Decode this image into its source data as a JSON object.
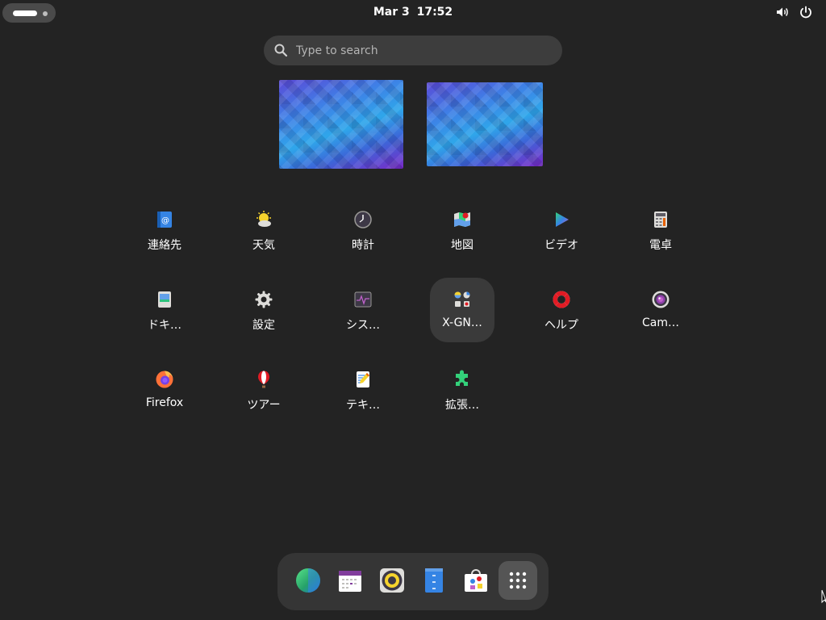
{
  "topbar": {
    "date": "Mar 3",
    "time": "17:52",
    "icons": [
      "activities-indicator",
      "volume-icon",
      "power-icon"
    ]
  },
  "search": {
    "placeholder": "Type to search"
  },
  "workspaces": {
    "count": 2
  },
  "app_grid": {
    "rows": [
      [
        {
          "label": "連絡先",
          "icon": "contacts-icon"
        },
        {
          "label": "天気",
          "icon": "weather-icon"
        },
        {
          "label": "時計",
          "icon": "clock-icon"
        },
        {
          "label": "地図",
          "icon": "maps-icon"
        },
        {
          "label": "ビデオ",
          "icon": "video-icon"
        },
        {
          "label": "電卓",
          "icon": "calculator-icon"
        }
      ],
      [
        {
          "label": "ドキ…",
          "icon": "document-viewer-icon"
        },
        {
          "label": "設定",
          "icon": "settings-gear-icon"
        },
        {
          "label": "シス…",
          "icon": "system-monitor-icon"
        },
        {
          "label": "X-GN…",
          "icon": "app-folder-icon",
          "highlighted": true
        },
        {
          "label": "ヘルプ",
          "icon": "help-lifebuoy-icon"
        },
        {
          "label": "Cam…",
          "icon": "camera-icon"
        }
      ],
      [
        {
          "label": "Firefox",
          "icon": "firefox-icon"
        },
        {
          "label": "ツアー",
          "icon": "tour-balloon-icon"
        },
        {
          "label": "テキ…",
          "icon": "text-editor-icon"
        },
        {
          "label": "拡張…",
          "icon": "extensions-puzzle-icon"
        }
      ]
    ]
  },
  "dash": {
    "items": [
      {
        "icon": "web-browser-globe-icon"
      },
      {
        "icon": "calendar-icon"
      },
      {
        "icon": "rhythmbox-music-icon"
      },
      {
        "icon": "files-icon"
      },
      {
        "icon": "software-store-icon"
      },
      {
        "icon": "show-apps-grid-icon",
        "active": true
      }
    ]
  }
}
